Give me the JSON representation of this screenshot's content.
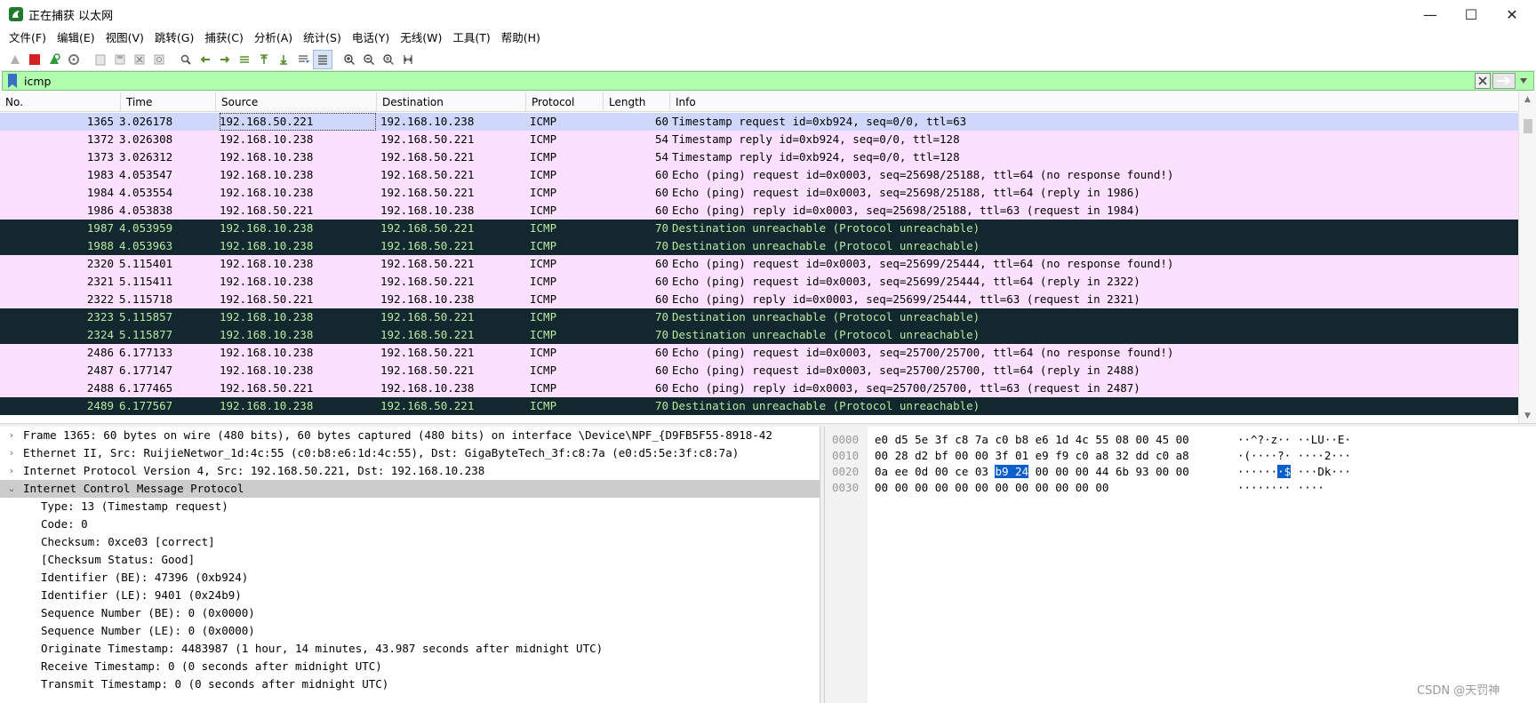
{
  "window": {
    "title": "正在捕获 以太网",
    "min_glyph": "—",
    "max_glyph": "☐",
    "close_glyph": "✕"
  },
  "menu": {
    "items": [
      "文件(F)",
      "编辑(E)",
      "视图(V)",
      "跳转(G)",
      "捕获(C)",
      "分析(A)",
      "统计(S)",
      "电话(Y)",
      "无线(W)",
      "工具(T)",
      "帮助(H)"
    ]
  },
  "filter": {
    "value": "icmp",
    "plus": "+"
  },
  "colors": {
    "selected_row": "#cfd7fd",
    "icmp_row": "#fce0ff",
    "error_row_bg": "#12272e",
    "error_row_fg": "#b9e8a3",
    "filter_bg": "#afffaf",
    "bytes_highlight": "#0a5fcd"
  },
  "packet_list": {
    "columns": [
      "No.",
      "Time",
      "Source",
      "Destination",
      "Protocol",
      "Length",
      "Info"
    ],
    "rows": [
      {
        "no": "1365",
        "time": "3.026178",
        "src": "192.168.50.221",
        "dst": "192.168.10.238",
        "proto": "ICMP",
        "len": "60",
        "info": "Timestamp request    id=0xb924, seq=0/0, ttl=63",
        "kind": "selected"
      },
      {
        "no": "1372",
        "time": "3.026308",
        "src": "192.168.10.238",
        "dst": "192.168.50.221",
        "proto": "ICMP",
        "len": "54",
        "info": "Timestamp reply      id=0xb924, seq=0/0, ttl=128",
        "kind": "icmp"
      },
      {
        "no": "1373",
        "time": "3.026312",
        "src": "192.168.10.238",
        "dst": "192.168.50.221",
        "proto": "ICMP",
        "len": "54",
        "info": "Timestamp reply      id=0xb924, seq=0/0, ttl=128",
        "kind": "icmp"
      },
      {
        "no": "1983",
        "time": "4.053547",
        "src": "192.168.10.238",
        "dst": "192.168.50.221",
        "proto": "ICMP",
        "len": "60",
        "info": "Echo (ping) request  id=0x0003, seq=25698/25188, ttl=64 (no response found!)",
        "kind": "icmp"
      },
      {
        "no": "1984",
        "time": "4.053554",
        "src": "192.168.10.238",
        "dst": "192.168.50.221",
        "proto": "ICMP",
        "len": "60",
        "info": "Echo (ping) request  id=0x0003, seq=25698/25188, ttl=64 (reply in 1986)",
        "kind": "icmp"
      },
      {
        "no": "1986",
        "time": "4.053838",
        "src": "192.168.50.221",
        "dst": "192.168.10.238",
        "proto": "ICMP",
        "len": "60",
        "info": "Echo (ping) reply    id=0x0003, seq=25698/25188, ttl=63 (request in 1984)",
        "kind": "icmp"
      },
      {
        "no": "1987",
        "time": "4.053959",
        "src": "192.168.10.238",
        "dst": "192.168.50.221",
        "proto": "ICMP",
        "len": "70",
        "info": "Destination unreachable (Protocol unreachable)",
        "kind": "error"
      },
      {
        "no": "1988",
        "time": "4.053963",
        "src": "192.168.10.238",
        "dst": "192.168.50.221",
        "proto": "ICMP",
        "len": "70",
        "info": "Destination unreachable (Protocol unreachable)",
        "kind": "error"
      },
      {
        "no": "2320",
        "time": "5.115401",
        "src": "192.168.10.238",
        "dst": "192.168.50.221",
        "proto": "ICMP",
        "len": "60",
        "info": "Echo (ping) request  id=0x0003, seq=25699/25444, ttl=64 (no response found!)",
        "kind": "icmp"
      },
      {
        "no": "2321",
        "time": "5.115411",
        "src": "192.168.10.238",
        "dst": "192.168.50.221",
        "proto": "ICMP",
        "len": "60",
        "info": "Echo (ping) request  id=0x0003, seq=25699/25444, ttl=64 (reply in 2322)",
        "kind": "icmp"
      },
      {
        "no": "2322",
        "time": "5.115718",
        "src": "192.168.50.221",
        "dst": "192.168.10.238",
        "proto": "ICMP",
        "len": "60",
        "info": "Echo (ping) reply    id=0x0003, seq=25699/25444, ttl=63 (request in 2321)",
        "kind": "icmp"
      },
      {
        "no": "2323",
        "time": "5.115857",
        "src": "192.168.10.238",
        "dst": "192.168.50.221",
        "proto": "ICMP",
        "len": "70",
        "info": "Destination unreachable (Protocol unreachable)",
        "kind": "error"
      },
      {
        "no": "2324",
        "time": "5.115877",
        "src": "192.168.10.238",
        "dst": "192.168.50.221",
        "proto": "ICMP",
        "len": "70",
        "info": "Destination unreachable (Protocol unreachable)",
        "kind": "error"
      },
      {
        "no": "2486",
        "time": "6.177133",
        "src": "192.168.10.238",
        "dst": "192.168.50.221",
        "proto": "ICMP",
        "len": "60",
        "info": "Echo (ping) request  id=0x0003, seq=25700/25700, ttl=64 (no response found!)",
        "kind": "icmp"
      },
      {
        "no": "2487",
        "time": "6.177147",
        "src": "192.168.10.238",
        "dst": "192.168.50.221",
        "proto": "ICMP",
        "len": "60",
        "info": "Echo (ping) request  id=0x0003, seq=25700/25700, ttl=64 (reply in 2488)",
        "kind": "icmp"
      },
      {
        "no": "2488",
        "time": "6.177465",
        "src": "192.168.50.221",
        "dst": "192.168.10.238",
        "proto": "ICMP",
        "len": "60",
        "info": "Echo (ping) reply    id=0x0003, seq=25700/25700, ttl=63 (request in 2487)",
        "kind": "icmp"
      },
      {
        "no": "2489",
        "time": "6.177567",
        "src": "192.168.10.238",
        "dst": "192.168.50.221",
        "proto": "ICMP",
        "len": "70",
        "info": "Destination unreachable (Protocol unreachable)",
        "kind": "error"
      }
    ]
  },
  "details": {
    "rows": [
      {
        "text": "Frame 1365: 60 bytes on wire (480 bits), 60 bytes captured (480 bits) on interface \\Device\\NPF_{D9FB5F55-8918-42",
        "toggle": "›",
        "indent": 0
      },
      {
        "text": "Ethernet II, Src: RuijieNetwor_1d:4c:55 (c0:b8:e6:1d:4c:55), Dst: GigaByteTech_3f:c8:7a (e0:d5:5e:3f:c8:7a)",
        "toggle": "›",
        "indent": 0
      },
      {
        "text": "Internet Protocol Version 4, Src: 192.168.50.221, Dst: 192.168.10.238",
        "toggle": "›",
        "indent": 0
      },
      {
        "text": "Internet Control Message Protocol",
        "toggle": "⌄",
        "indent": 0,
        "selected": true
      },
      {
        "text": "Type: 13 (Timestamp request)",
        "toggle": "",
        "indent": 1
      },
      {
        "text": "Code: 0",
        "toggle": "",
        "indent": 1
      },
      {
        "text": "Checksum: 0xce03 [correct]",
        "toggle": "",
        "indent": 1
      },
      {
        "text": "[Checksum Status: Good]",
        "toggle": "",
        "indent": 1
      },
      {
        "text": "Identifier (BE): 47396 (0xb924)",
        "toggle": "",
        "indent": 1
      },
      {
        "text": "Identifier (LE): 9401 (0x24b9)",
        "toggle": "",
        "indent": 1
      },
      {
        "text": "Sequence Number (BE): 0 (0x0000)",
        "toggle": "",
        "indent": 1
      },
      {
        "text": "Sequence Number (LE): 0 (0x0000)",
        "toggle": "",
        "indent": 1
      },
      {
        "text": "Originate Timestamp: 4483987 (1 hour, 14 minutes, 43.987 seconds after midnight UTC)",
        "toggle": "",
        "indent": 1
      },
      {
        "text": "Receive Timestamp: 0 (0 seconds after midnight UTC)",
        "toggle": "",
        "indent": 1
      },
      {
        "text": "Transmit Timestamp: 0 (0 seconds after midnight UTC)",
        "toggle": "",
        "indent": 1
      }
    ]
  },
  "bytes": {
    "rows": [
      {
        "offset": "0000",
        "hex_pre": "e0 d5 5e 3f c8 7a c0 b8  e6 1d 4c 55 08 00 45 00",
        "hex_hl": "",
        "hex_post": "",
        "asc_pre": "··^?·z·· ··LU··E·",
        "asc_hl": "",
        "asc_post": ""
      },
      {
        "offset": "0010",
        "hex_pre": "00 28 d2 bf 00 00 3f 01  e9 f9 c0 a8 32 dd c0 a8",
        "hex_hl": "",
        "hex_post": "",
        "asc_pre": "·(····?· ····2···",
        "asc_hl": "",
        "asc_post": ""
      },
      {
        "offset": "0020",
        "hex_pre": "0a ee 0d 00 ce 03 ",
        "hex_hl": "b9 24",
        "hex_post": "  00 00 00 44 6b 93 00 00",
        "asc_pre": "······",
        "asc_hl": "·$",
        "asc_post": " ···Dk···"
      },
      {
        "offset": "0030",
        "hex_pre": "00 00 00 00 00 00 00 00  00 00 00 00",
        "hex_hl": "",
        "hex_post": "",
        "asc_pre": "········ ····",
        "asc_hl": "",
        "asc_post": ""
      }
    ]
  },
  "watermark": "CSDN @天罚神"
}
